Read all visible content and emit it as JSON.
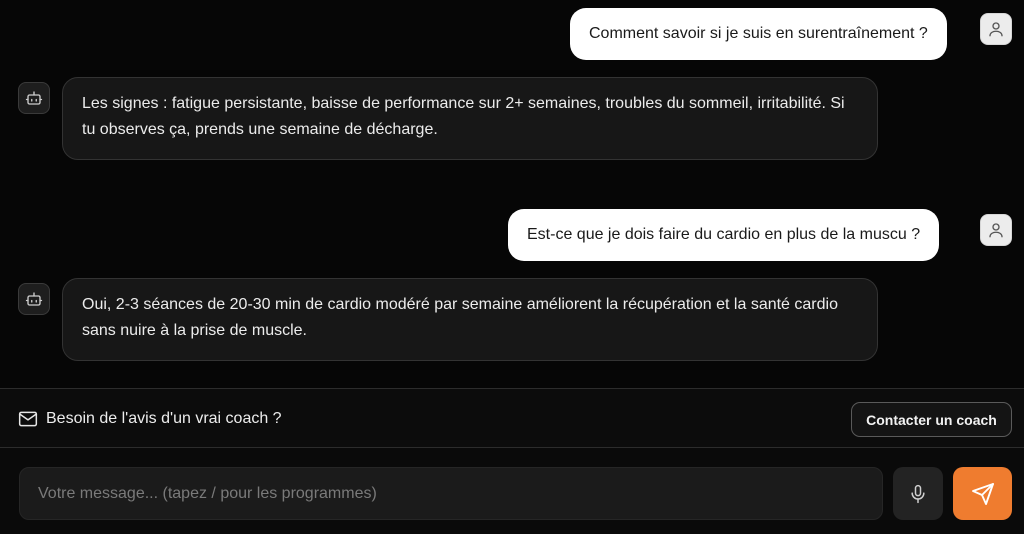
{
  "messages": [
    {
      "role": "user",
      "text": "Comment savoir si je suis en surentraînement ?"
    },
    {
      "role": "bot",
      "text": "Les signes : fatigue persistante, baisse de performance sur 2+ semaines, troubles du sommeil, irritabilité. Si tu observes ça, prends une semaine de décharge."
    },
    {
      "role": "user",
      "text": "Est-ce que je dois faire du cardio en plus de la muscu ?"
    },
    {
      "role": "bot",
      "text": "Oui, 2-3 séances de 20-30 min de cardio modéré par semaine améliorent la récupération et la santé cardio sans nuire à la prise de muscle."
    }
  ],
  "coach_bar": {
    "icon": "mail-icon",
    "label": "Besoin de l'avis d'un vrai coach ?",
    "button_label": "Contacter un coach"
  },
  "composer": {
    "placeholder": "Votre message... (tapez / pour les programmes)",
    "value": "",
    "mic_icon": "microphone-icon",
    "send_icon": "send-icon"
  },
  "colors": {
    "background": "#060606",
    "accent": "#ef7c2f",
    "user_bubble": "#ffffff",
    "bot_bubble": "#171717"
  }
}
